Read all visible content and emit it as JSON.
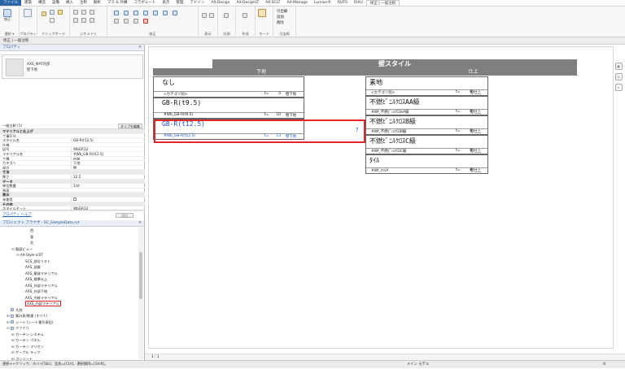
{
  "ribbon_tabs": [
    "ファイル",
    "建築",
    "構造",
    "設備",
    "挿入",
    "注釈",
    "解析",
    "マス & 外構",
    "コラボレート",
    "表示",
    "管理",
    "アドイン",
    "AX-Design",
    "AX-DesignLT",
    "AX-SCLT",
    "AX-Manage",
    "Lumion®",
    "RUTS",
    "RIXU",
    "修正 | 一般注釈"
  ],
  "ribbon": {
    "select_label": "選択 ▾",
    "properties_label": "プロパティ",
    "clipboard_label": "クリップボード",
    "geometry_label": "ジオメトリ",
    "modify_label": "修正",
    "view_label": "表示",
    "measure_label": "計測",
    "create_label": "作成",
    "mode_label": "モード",
    "leader_label": "引出線",
    "modify_btn": "修正",
    "family_edit": "ファミリを編集",
    "add_leader": "引出線",
    "add_label": "追加",
    "remove_label": "削除"
  },
  "context_bar": "修正 | 一般注釈",
  "properties": {
    "title": "プロパティ",
    "type_name_1": "AXS_MAT内部",
    "type_name_2": "壁下地",
    "filter": "一般注釈 (1)",
    "edit_type": "タイプを編集",
    "rows": [
      {
        "name": "マテリアルと仕上げ",
        "value": "",
        "sec": true
      },
      {
        "name": "工事区分",
        "value": ""
      },
      {
        "name": "スタイル名",
        "value": "GB-R(t12.5)"
      },
      {
        "name": "仕様",
        "value": ""
      },
      {
        "name": "記号",
        "value": "WbGR12"
      },
      {
        "name": "マテリアル名",
        "value": "#Wb_GB-R(t12.5)"
      },
      {
        "name": "工種",
        "value": "内装"
      },
      {
        "name": "カテゴリ",
        "value": "下地"
      },
      {
        "name": "部位",
        "value": "壁"
      },
      {
        "name": "寸法",
        "value": "",
        "sec": true
      },
      {
        "name": "厚さ",
        "value": "12.5"
      },
      {
        "name": "データ",
        "value": "",
        "sec": true
      },
      {
        "name": "単位数量",
        "value": "1/st"
      },
      {
        "name": "表面",
        "value": ""
      },
      {
        "name": "表示",
        "value": "",
        "sec": true
      },
      {
        "name": "未使用",
        "value": "",
        "check": true
      },
      {
        "name": "その他",
        "value": "",
        "sec": true
      },
      {
        "name": "スタイルセット",
        "value": "WbGR12"
      }
    ],
    "help_link": "プロパティ ヘルプ",
    "apply": "適用"
  },
  "browser": {
    "title": "プロジェクト ブラウザ - SC_SampleData.rvt",
    "nodes": [
      {
        "label": "西",
        "indent": 5,
        "toggle": "",
        "icon": false
      },
      {
        "label": "東",
        "indent": 5,
        "toggle": "",
        "icon": false
      },
      {
        "label": "北",
        "indent": 5,
        "toggle": "",
        "icon": false
      },
      {
        "label": "製図ビュー",
        "indent": 2,
        "toggle": "⊟",
        "icon": false
      },
      {
        "label": "AX-Style LIST",
        "indent": 3,
        "toggle": "⊟",
        "icon": false
      },
      {
        "label": "SCS_部位リスト",
        "indent": 4,
        "toggle": "",
        "icon": false
      },
      {
        "label": "AXS_部屋",
        "indent": 4,
        "toggle": "",
        "icon": false
      },
      {
        "label": "AXS_躯体マテリアル",
        "indent": 4,
        "toggle": "",
        "icon": false
      },
      {
        "label": "AXS_標準仕上",
        "indent": 4,
        "toggle": "",
        "icon": false
      },
      {
        "label": "AXS_外部マテリアル",
        "indent": 4,
        "toggle": "",
        "icon": false
      },
      {
        "label": "AXS_外部下地",
        "indent": 4,
        "toggle": "",
        "icon": false
      },
      {
        "label": "AXS_内装マテリアル",
        "indent": 4,
        "toggle": "",
        "icon": false
      },
      {
        "label": "AXS_内部マテリアル",
        "indent": 4,
        "toggle": "",
        "icon": false,
        "selected": true
      },
      {
        "label": "凡例",
        "indent": 1,
        "toggle": "",
        "icon": true
      },
      {
        "label": "集計表/数量 (すべて)",
        "indent": 1,
        "toggle": "⊞",
        "icon": true
      },
      {
        "label": "シート (シート番号表記)",
        "indent": 1,
        "toggle": "⊞",
        "icon": true
      },
      {
        "label": "ファミリ",
        "indent": 1,
        "toggle": "⊟",
        "icon": true
      },
      {
        "label": "カーテン システム",
        "indent": 2,
        "toggle": "⊞",
        "icon": false
      },
      {
        "label": "カーテン パネル",
        "indent": 2,
        "toggle": "⊞",
        "icon": false
      },
      {
        "label": "カーテン マリオン",
        "indent": 2,
        "toggle": "⊞",
        "icon": false
      },
      {
        "label": "ケーブル ラック",
        "indent": 2,
        "toggle": "⊞",
        "icon": false
      },
      {
        "label": "コンジット",
        "indent": 2,
        "toggle": "⊞",
        "icon": false
      }
    ]
  },
  "schedule": {
    "title": "壁スタイル",
    "col_left": "下地",
    "col_right": "仕上",
    "left_rows": [
      {
        "name": "なし",
        "sub": "<カテゴリ別>",
        "t": "0",
        "pos": "壁下地"
      },
      {
        "name": "GB-R(t9.5)",
        "sub": "#Wb_GB-R(t9.5)",
        "t": "10",
        "pos": "壁下地"
      },
      {
        "name": "GB-R(t12.5)",
        "sub": "#Wb_GB-R(t12.5)",
        "t": "13",
        "pos": "壁下地"
      }
    ],
    "right_rows": [
      {
        "name": "素地",
        "sub": "<カテゴリ別>",
        "t": "0",
        "pos": "壁仕上"
      },
      {
        "name": "不燃ﾋﾞﾆﾙｸﾛｽAA級",
        "sub": "#Wf_不燃ﾋﾞﾆﾙｸﾛｽAA級",
        "t": "0",
        "pos": "壁仕上"
      },
      {
        "name": "不燃ﾋﾞﾆﾙｸﾛｽB級",
        "sub": "#Wf_不燃ﾋﾞﾆﾙｸﾛｽB級",
        "t": "0",
        "pos": "壁仕上"
      },
      {
        "name": "不燃ﾋﾞﾆﾙｸﾛｽC級",
        "sub": "#Wf_不燃ﾋﾞﾆﾙｸﾛｽC級",
        "t": "0",
        "pos": "壁仕上"
      },
      {
        "name": "ﾀｲﾙ",
        "sub": "#Wf_ﾀｲﾙA",
        "t": "8",
        "pos": "壁仕上"
      }
    ],
    "t_prefix": "t=",
    "question": "?"
  },
  "view_control": {
    "scale": "1 : 1"
  },
  "status": {
    "text": "選択++クリック、ホバ+[Tab]、追加=[Ctrl]、選択解除=[Shift]。",
    "model": "メイン モデル",
    "filter": ":0"
  },
  "colors": {
    "highlight": "#e0262b",
    "blue_text": "#1f4fd0",
    "header_fill": "#7f7f7f",
    "file_tab": "#2a63a8"
  }
}
